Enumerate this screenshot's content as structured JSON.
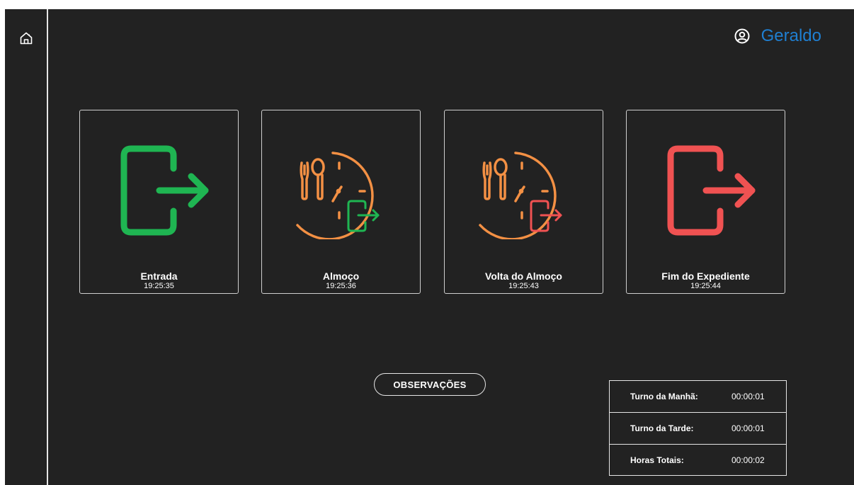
{
  "sidebar": {
    "home_icon": "home-icon"
  },
  "header": {
    "user_name": "Geraldo",
    "user_icon": "user-circle-icon",
    "accent": "#1f7fd1"
  },
  "cards": [
    {
      "label": "Entrada",
      "time": "19:25:35",
      "icon": "exit-arrow-icon",
      "color": "#1fb552"
    },
    {
      "label": "Almoço",
      "time": "19:25:36",
      "icon": "lunch-clock-icon",
      "color": "#f39044"
    },
    {
      "label": "Volta do Almoço",
      "time": "19:25:43",
      "icon": "lunch-return-clock-icon",
      "color": "#f39044"
    },
    {
      "label": "Fim do Expediente",
      "time": "19:25:44",
      "icon": "exit-arrow-icon",
      "color": "#f05252"
    }
  ],
  "observations_button": "OBSERVAÇÕES",
  "hours_table": [
    {
      "label": "Turno da Manhã:",
      "value": "00:00:01"
    },
    {
      "label": "Turno da Tarde:",
      "value": "00:00:01"
    },
    {
      "label": "Horas Totais:",
      "value": "00:00:02"
    }
  ]
}
